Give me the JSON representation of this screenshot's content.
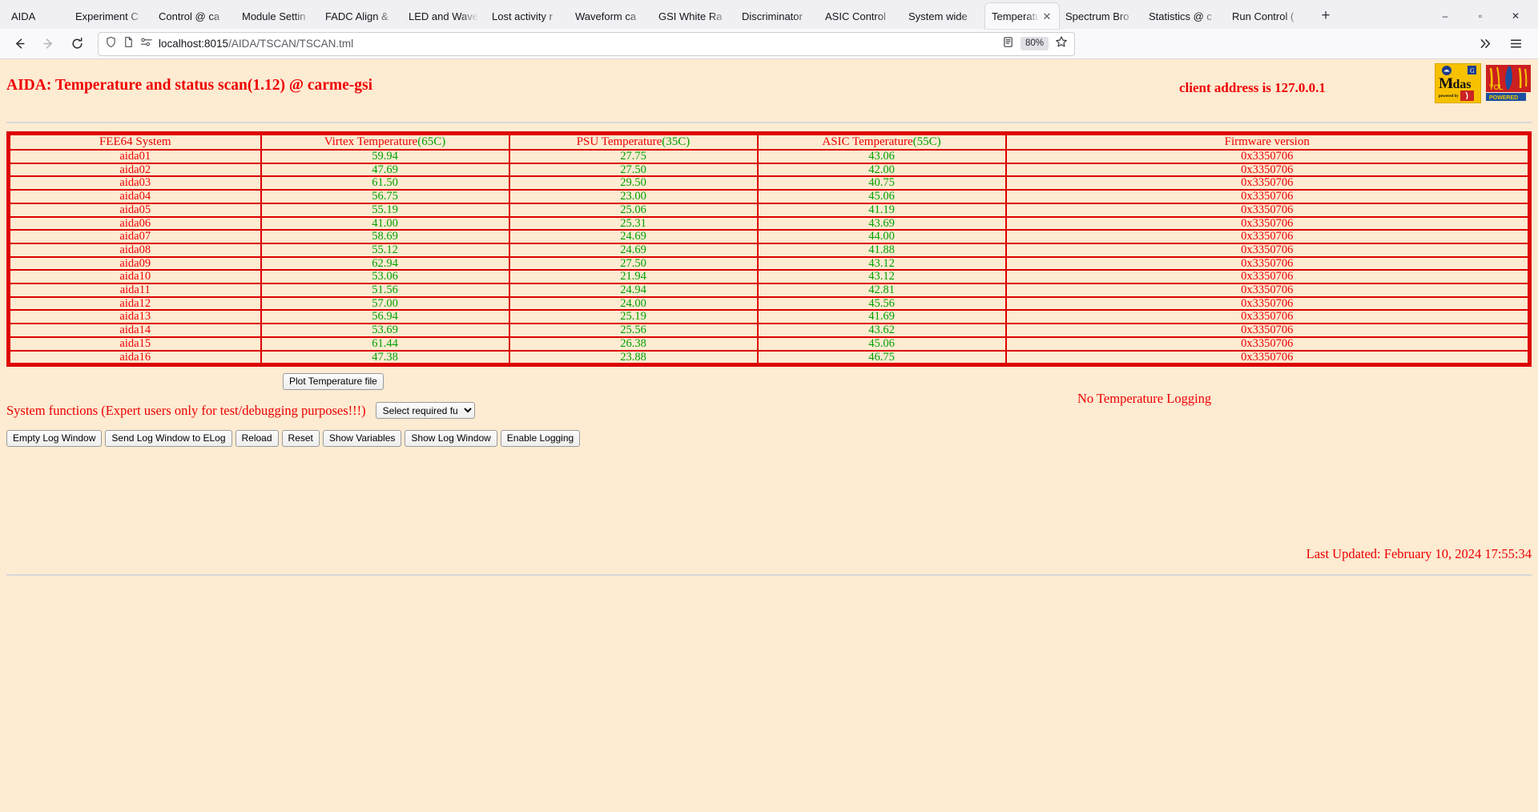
{
  "browser": {
    "tabs": [
      {
        "label": "AIDA",
        "active": false,
        "brand": true
      },
      {
        "label": "Experiment C",
        "active": false
      },
      {
        "label": "Control @ ca",
        "active": false
      },
      {
        "label": "Module Settin",
        "active": false
      },
      {
        "label": "FADC Align &",
        "active": false
      },
      {
        "label": "LED and Wave",
        "active": false
      },
      {
        "label": "Lost activity r",
        "active": false
      },
      {
        "label": "Waveform ca",
        "active": false
      },
      {
        "label": "GSI White Ra",
        "active": false
      },
      {
        "label": "Discriminator",
        "active": false
      },
      {
        "label": "ASIC Control",
        "active": false
      },
      {
        "label": "System wide",
        "active": false
      },
      {
        "label": "Temperatur",
        "active": true
      },
      {
        "label": "Spectrum Bro",
        "active": false
      },
      {
        "label": "Statistics @ c",
        "active": false
      },
      {
        "label": "Run Control (",
        "active": false
      }
    ],
    "new_tab_label": "+",
    "window_controls": {
      "minimize": "–",
      "maximize": "▫",
      "close": "✕"
    },
    "nav": {
      "back_icon": "back-arrow-icon",
      "forward_icon": "forward-arrow-icon",
      "reload_icon": "reload-icon",
      "shield_icon": "shield-icon",
      "page_icon": "page-icon",
      "permissions_icon": "permissions-icon"
    },
    "url": {
      "host": "localhost:8015",
      "path": "/AIDA/TSCAN/TSCAN.tml"
    },
    "zoom_level": "80%",
    "reader_icon": "reader-view-icon",
    "bookmark_icon": "star-icon",
    "overflow_icon": "chevron-double-right-icon",
    "menu_icon": "hamburger-menu-icon"
  },
  "page": {
    "title": "AIDA: Temperature and status scan(1.12) @ carme-gsi",
    "client_address": "client address is 127.0.0.1",
    "logos": {
      "midas": "midas-logo",
      "midas_text": "Midas",
      "midas_sub": "powered by",
      "tcl": "tcl-logo",
      "tcl_text": "TCL",
      "tcl_sub": "POWERED"
    },
    "table": {
      "headers": [
        {
          "label": "FEE64 System",
          "limit": ""
        },
        {
          "label": "Virtex Temperature",
          "limit": "(65C)"
        },
        {
          "label": "PSU Temperature",
          "limit": "(35C)"
        },
        {
          "label": "ASIC Temperature",
          "limit": "(55C)"
        },
        {
          "label": "Firmware version",
          "limit": ""
        }
      ],
      "rows": [
        {
          "system": "aida01",
          "virtex": "59.94",
          "psu": "27.75",
          "asic": "43.06",
          "firmware": "0x3350706"
        },
        {
          "system": "aida02",
          "virtex": "47.69",
          "psu": "27.50",
          "asic": "42.00",
          "firmware": "0x3350706"
        },
        {
          "system": "aida03",
          "virtex": "61.50",
          "psu": "29.50",
          "asic": "40.75",
          "firmware": "0x3350706"
        },
        {
          "system": "aida04",
          "virtex": "56.75",
          "psu": "23.00",
          "asic": "45.06",
          "firmware": "0x3350706"
        },
        {
          "system": "aida05",
          "virtex": "55.19",
          "psu": "25.06",
          "asic": "41.19",
          "firmware": "0x3350706"
        },
        {
          "system": "aida06",
          "virtex": "41.00",
          "psu": "25.31",
          "asic": "43.69",
          "firmware": "0x3350706"
        },
        {
          "system": "aida07",
          "virtex": "58.69",
          "psu": "24.69",
          "asic": "44.00",
          "firmware": "0x3350706"
        },
        {
          "system": "aida08",
          "virtex": "55.12",
          "psu": "24.69",
          "asic": "41.88",
          "firmware": "0x3350706"
        },
        {
          "system": "aida09",
          "virtex": "62.94",
          "psu": "27.50",
          "asic": "43.12",
          "firmware": "0x3350706"
        },
        {
          "system": "aida10",
          "virtex": "53.06",
          "psu": "21.94",
          "asic": "43.12",
          "firmware": "0x3350706"
        },
        {
          "system": "aida11",
          "virtex": "51.56",
          "psu": "24.94",
          "asic": "42.81",
          "firmware": "0x3350706"
        },
        {
          "system": "aida12",
          "virtex": "57.00",
          "psu": "24.00",
          "asic": "45.56",
          "firmware": "0x3350706"
        },
        {
          "system": "aida13",
          "virtex": "56.94",
          "psu": "25.19",
          "asic": "41.69",
          "firmware": "0x3350706"
        },
        {
          "system": "aida14",
          "virtex": "53.69",
          "psu": "25.56",
          "asic": "43.62",
          "firmware": "0x3350706"
        },
        {
          "system": "aida15",
          "virtex": "61.44",
          "psu": "26.38",
          "asic": "45.06",
          "firmware": "0x3350706"
        },
        {
          "system": "aida16",
          "virtex": "47.38",
          "psu": "23.88",
          "asic": "46.75",
          "firmware": "0x3350706"
        }
      ]
    },
    "controls": {
      "plot_button": "Plot Temperature file",
      "logging_status": "No Temperature Logging",
      "system_functions_label": "System functions (Expert users only for test/debugging purposes!!!)",
      "function_select_value": "Select required function",
      "buttons": [
        "Empty Log Window",
        "Send Log Window to ELog",
        "Reload",
        "Reset",
        "Show Variables",
        "Show Log Window",
        "Enable Logging"
      ]
    },
    "last_updated": "Last Updated: February 10, 2024 17:55:34"
  }
}
